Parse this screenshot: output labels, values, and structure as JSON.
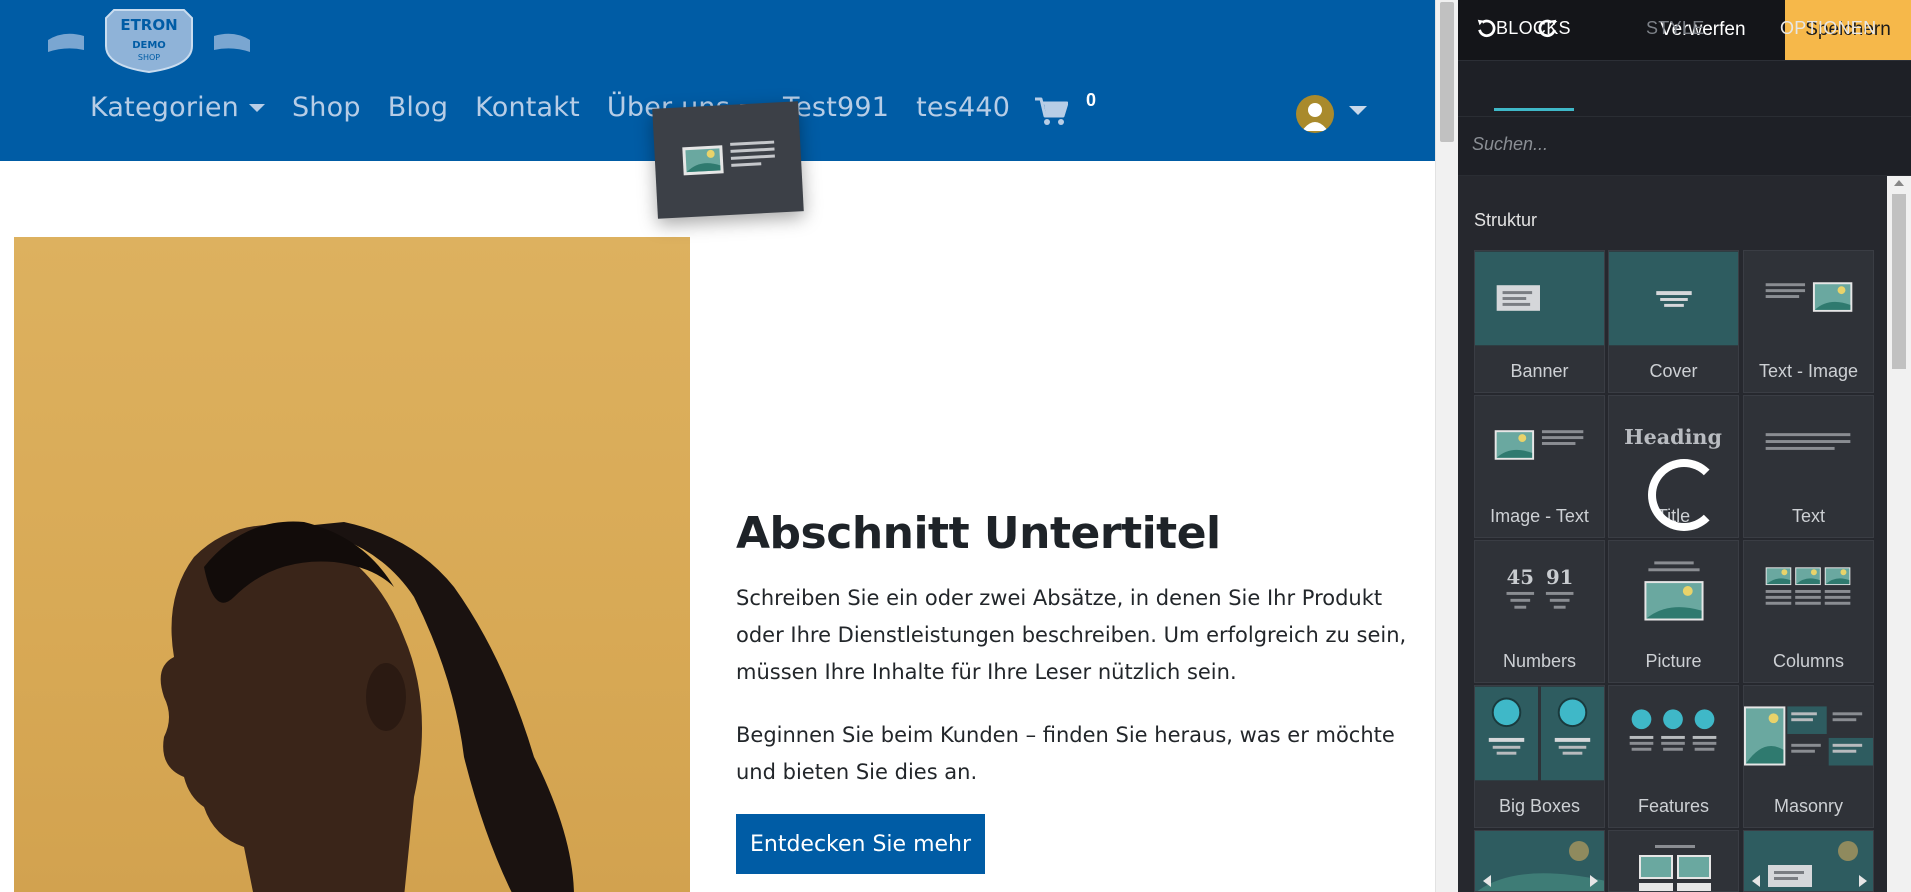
{
  "site": {
    "logo": {
      "name": "ETRON",
      "sub": "DEMO",
      "sub2": "SHOP"
    },
    "nav": [
      {
        "label": "Kategorien",
        "dropdown": true
      },
      {
        "label": "Shop",
        "dropdown": false
      },
      {
        "label": "Blog",
        "dropdown": false
      },
      {
        "label": "Kontakt",
        "dropdown": false
      },
      {
        "label": "Über uns",
        "dropdown": true
      },
      {
        "label": "Test991",
        "dropdown": false
      },
      {
        "label": "tes440",
        "dropdown": false
      }
    ],
    "cart_count": "0",
    "section": {
      "subtitle": "Abschnitt Untertitel",
      "para1": "Schreiben Sie ein oder zwei Absätze, in denen Sie Ihr Produkt oder Ihre Dienstleistungen beschreiben. Um erfolgreich zu sein, müssen Ihre Inhalte für Ihre Leser nützlich sein.",
      "para2": "Beginnen Sie beim Kunden – finden Sie heraus, was er möchte und bieten Sie dies an.",
      "cta": "Entdecken Sie mehr"
    },
    "colors": {
      "header": "#005ca5",
      "hero_bg": "#d9aa57"
    }
  },
  "editor": {
    "toolbar": {
      "undo_icon": "undo-icon",
      "redo_icon": "redo-icon",
      "discard_label": "Verwerfen",
      "save_label": "Speichern"
    },
    "tabs": {
      "blocks": "BLOCKS",
      "style": "STYLE",
      "options": "OPTIONEN"
    },
    "search_placeholder": "Suchen...",
    "section_label": "Struktur",
    "blocks": [
      "Banner",
      "Cover",
      "Text - Image",
      "Image - Text",
      "Title",
      "Text",
      "Numbers",
      "Picture",
      "Columns",
      "Big Boxes",
      "Features",
      "Masonry"
    ],
    "title_thumb_heading": "Heading",
    "numbers_thumb": [
      "45",
      "91"
    ],
    "colors": {
      "accent": "#3fb8c8",
      "save": "#f6b84a",
      "panel": "#141519"
    }
  }
}
